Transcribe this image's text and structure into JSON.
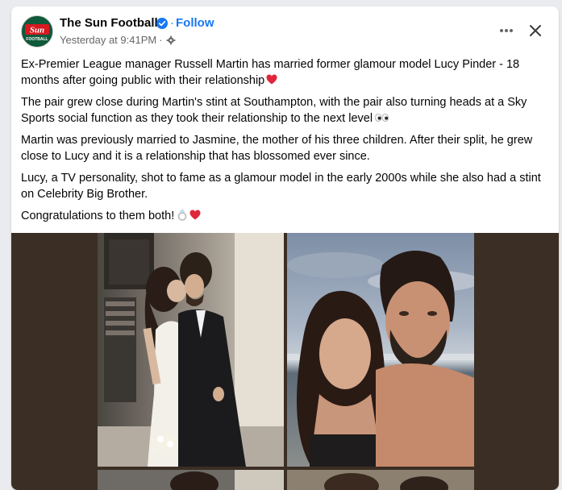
{
  "post": {
    "page_name": "The Sun Football",
    "follow_label": "Follow",
    "timestamp": "Yesterday at 9:41PM",
    "separator": "·",
    "avatar_text_top": "Sun",
    "avatar_text_bottom": "FOOTBALL",
    "paragraphs": [
      "Ex-Premier League manager Russell Martin has married former glamour model Lucy Pinder - 18 months after going public with their relationship",
      "The pair grew close during Martin's stint at Southampton, with the pair also  turning heads at a Sky Sports social function as they took their relationship to the next level",
      "Martin was previously married to Jasmine, the mother of his three children. After their split, he grew close to Lucy and it is a relationship that has blossomed ever since.",
      "Lucy, a TV personality, shot to fame as a glamour model in the early 2000s while she also had a stint on Celebrity Big Brother.",
      "Congratulations to them both!"
    ]
  },
  "icons": {
    "verified": "verified-badge-icon",
    "audience": "settings-gear-icon",
    "more": "more-options-icon",
    "close": "close-icon",
    "heart": "red-heart-emoji",
    "eyes": "eyes-emoji",
    "ring": "ring-emoji"
  },
  "colors": {
    "accent": "#1877f2",
    "secondary_text": "#65676b",
    "brand_red": "#d71920",
    "brand_green": "#0e5a3a",
    "media_background": "#3b2e24"
  }
}
